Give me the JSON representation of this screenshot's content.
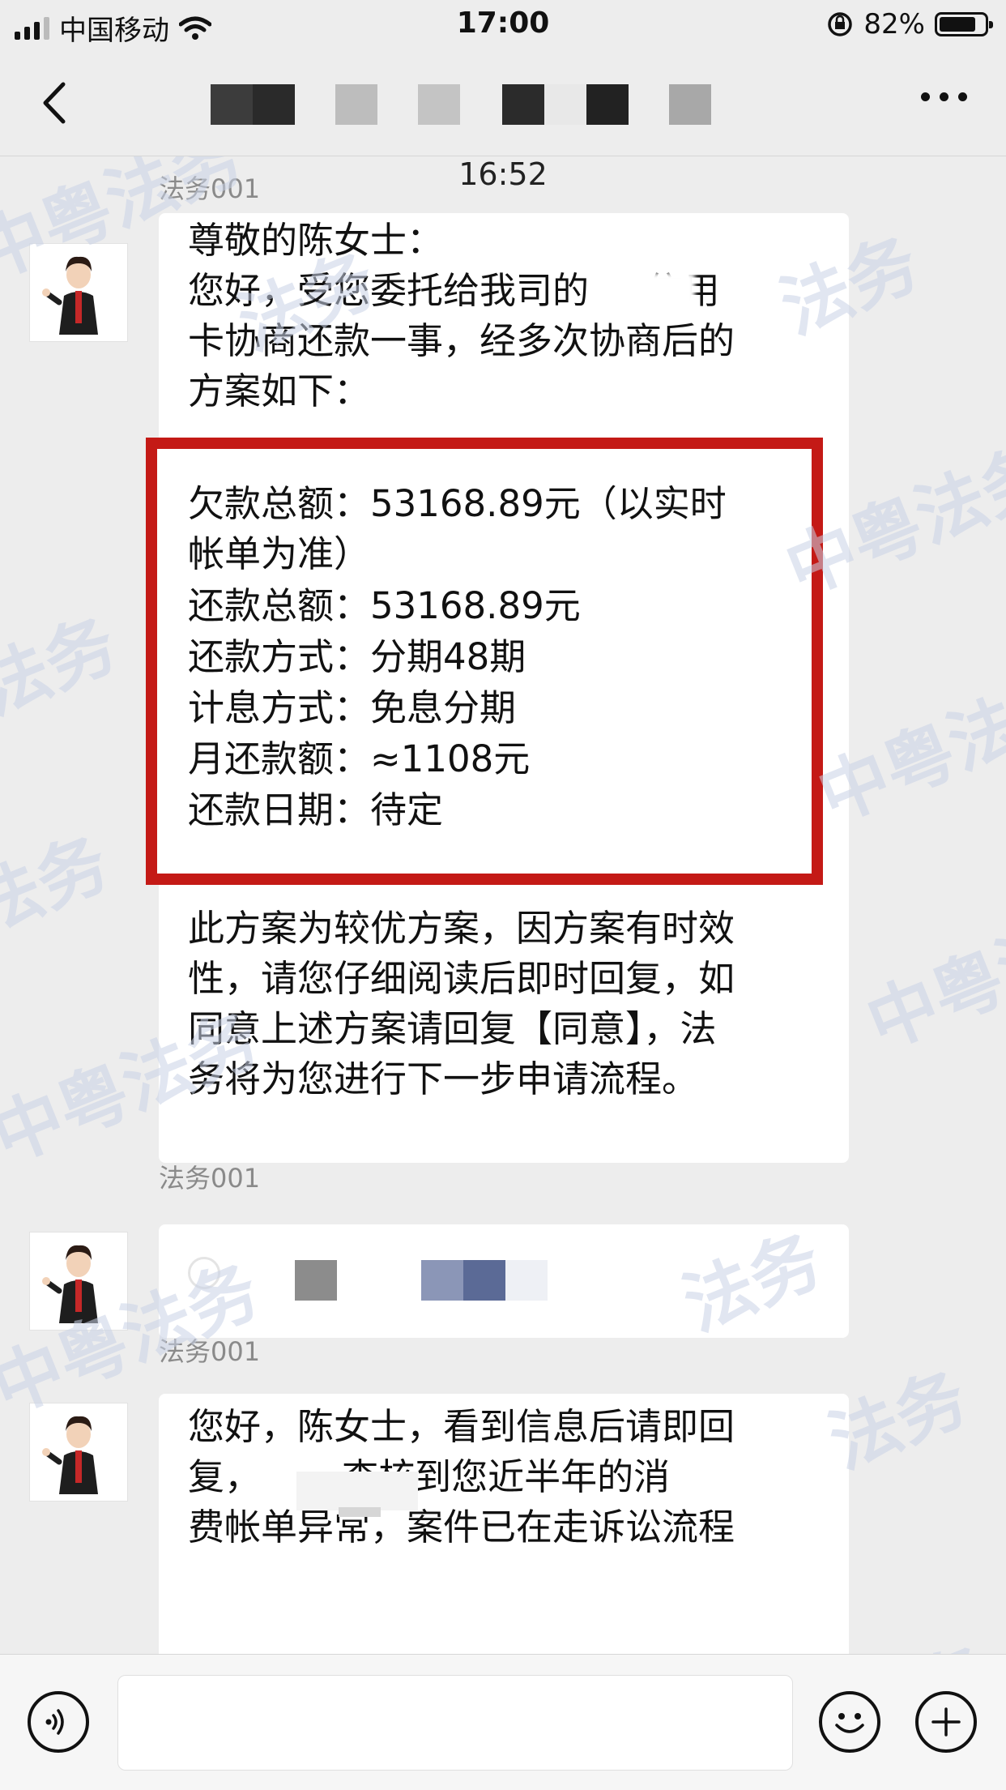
{
  "status_bar": {
    "carrier": "中国移动",
    "time": "17:00",
    "battery_percent": "82%",
    "battery_level": 0.82
  },
  "nav": {
    "back_icon": "chevron-left-icon",
    "more_icon": "more-dots-icon"
  },
  "chat": {
    "timestamp": "16:52",
    "messages": [
      {
        "sender": "法务001",
        "intro": "尊敬的陈女士：\n您好，受您委托给我司的     信用\n卡协商还款一事，经多次协商后的\n方案如下：",
        "plan": {
          "line1": "欠款总额：53168.89元（以实时\n帐单为准）",
          "line2": "还款总额：53168.89元",
          "line3": "还款方式：分期48期",
          "line4": "计息方式：免息分期",
          "line5": "月还款额：≈1108元",
          "line6": "还款日期：待定"
        },
        "outro": "此方案为较优方案，因方案有时效\n性，请您仔细阅读后即时回复，如\n同意上述方案请回复【同意】，法\n务将为您进行下一步申请流程。"
      },
      {
        "sender": "法务001"
      },
      {
        "sender": "法务001",
        "text": "您好，陈女士，看到信息后请即回\n复，       查核到您近半年的消\n费帐单异常，案件已在走诉讼流程"
      }
    ]
  },
  "watermark": {
    "text1": "中粤法务",
    "text2": "法务"
  },
  "colors": {
    "highlight_border": "#c41a16",
    "background": "#ededed"
  }
}
